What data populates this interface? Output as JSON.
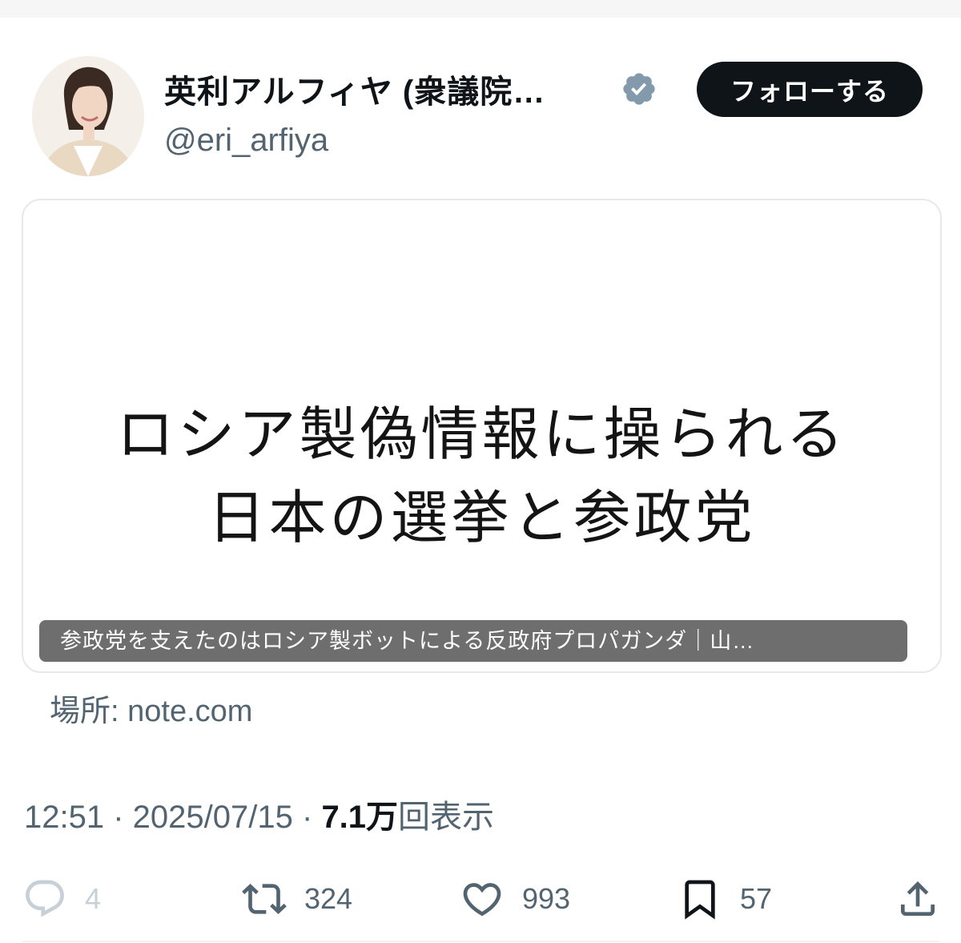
{
  "author": {
    "name": "英利アルフィヤ (衆議院…",
    "handle": "@eri_arfiya",
    "follow_label": "フォローする"
  },
  "card": {
    "headline_line1": "ロシア製偽情報に操られる",
    "headline_line2": "日本の選挙と参政党",
    "caption": "参政党を支えたのはロシア製ボットによる反政府プロパガンダ｜山…",
    "source": "場所: note.com"
  },
  "meta": {
    "time": "12:51",
    "date": "2025/07/15",
    "views_count": "7.1万",
    "views_label": "回表示"
  },
  "actions": {
    "replies": "4",
    "reposts": "324",
    "likes": "993",
    "bookmarks": "57"
  },
  "colors": {
    "verified": "#829aab",
    "secondary_text": "#536471",
    "follow_bg": "#0f1419"
  },
  "icons": [
    "verified-badge-icon",
    "reply-icon",
    "repost-icon",
    "like-icon",
    "bookmark-icon",
    "share-icon"
  ]
}
